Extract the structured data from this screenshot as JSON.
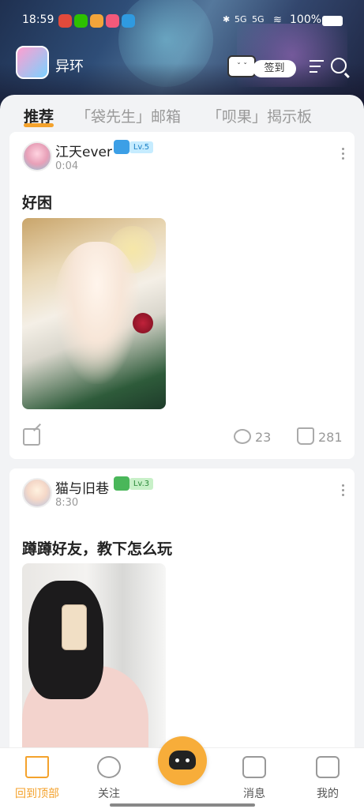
{
  "status_bar": {
    "time": "18:59",
    "battery": "100%",
    "signal_labels": [
      "5G",
      "5G"
    ]
  },
  "header": {
    "app_name": "异环",
    "signin_label": "签到"
  },
  "tabs": [
    {
      "label": "推荐",
      "active": true
    },
    {
      "label": "「袋先生」邮箱",
      "active": false
    },
    {
      "label": "「呗果」揭示板",
      "active": false
    }
  ],
  "posts": [
    {
      "username": "江天ever",
      "level": "Lv.5",
      "time": "0:04",
      "title": "好困",
      "comments": "23",
      "likes": "281"
    },
    {
      "username": "猫与旧巷",
      "level": "Lv.3",
      "time": "8:30",
      "title": "蹲蹲好友，教下怎么玩"
    }
  ],
  "bottom_nav": [
    {
      "label": "回到顶部",
      "icon": "home-icon",
      "active": true
    },
    {
      "label": "关注",
      "icon": "follow-icon",
      "active": false
    },
    {
      "label": "消息",
      "icon": "message-icon",
      "active": false
    },
    {
      "label": "我的",
      "icon": "profile-icon",
      "active": false
    }
  ],
  "colors": {
    "accent": "#f4a22c",
    "lv5": "#3c9fe6",
    "lv3": "#4ab75a"
  }
}
